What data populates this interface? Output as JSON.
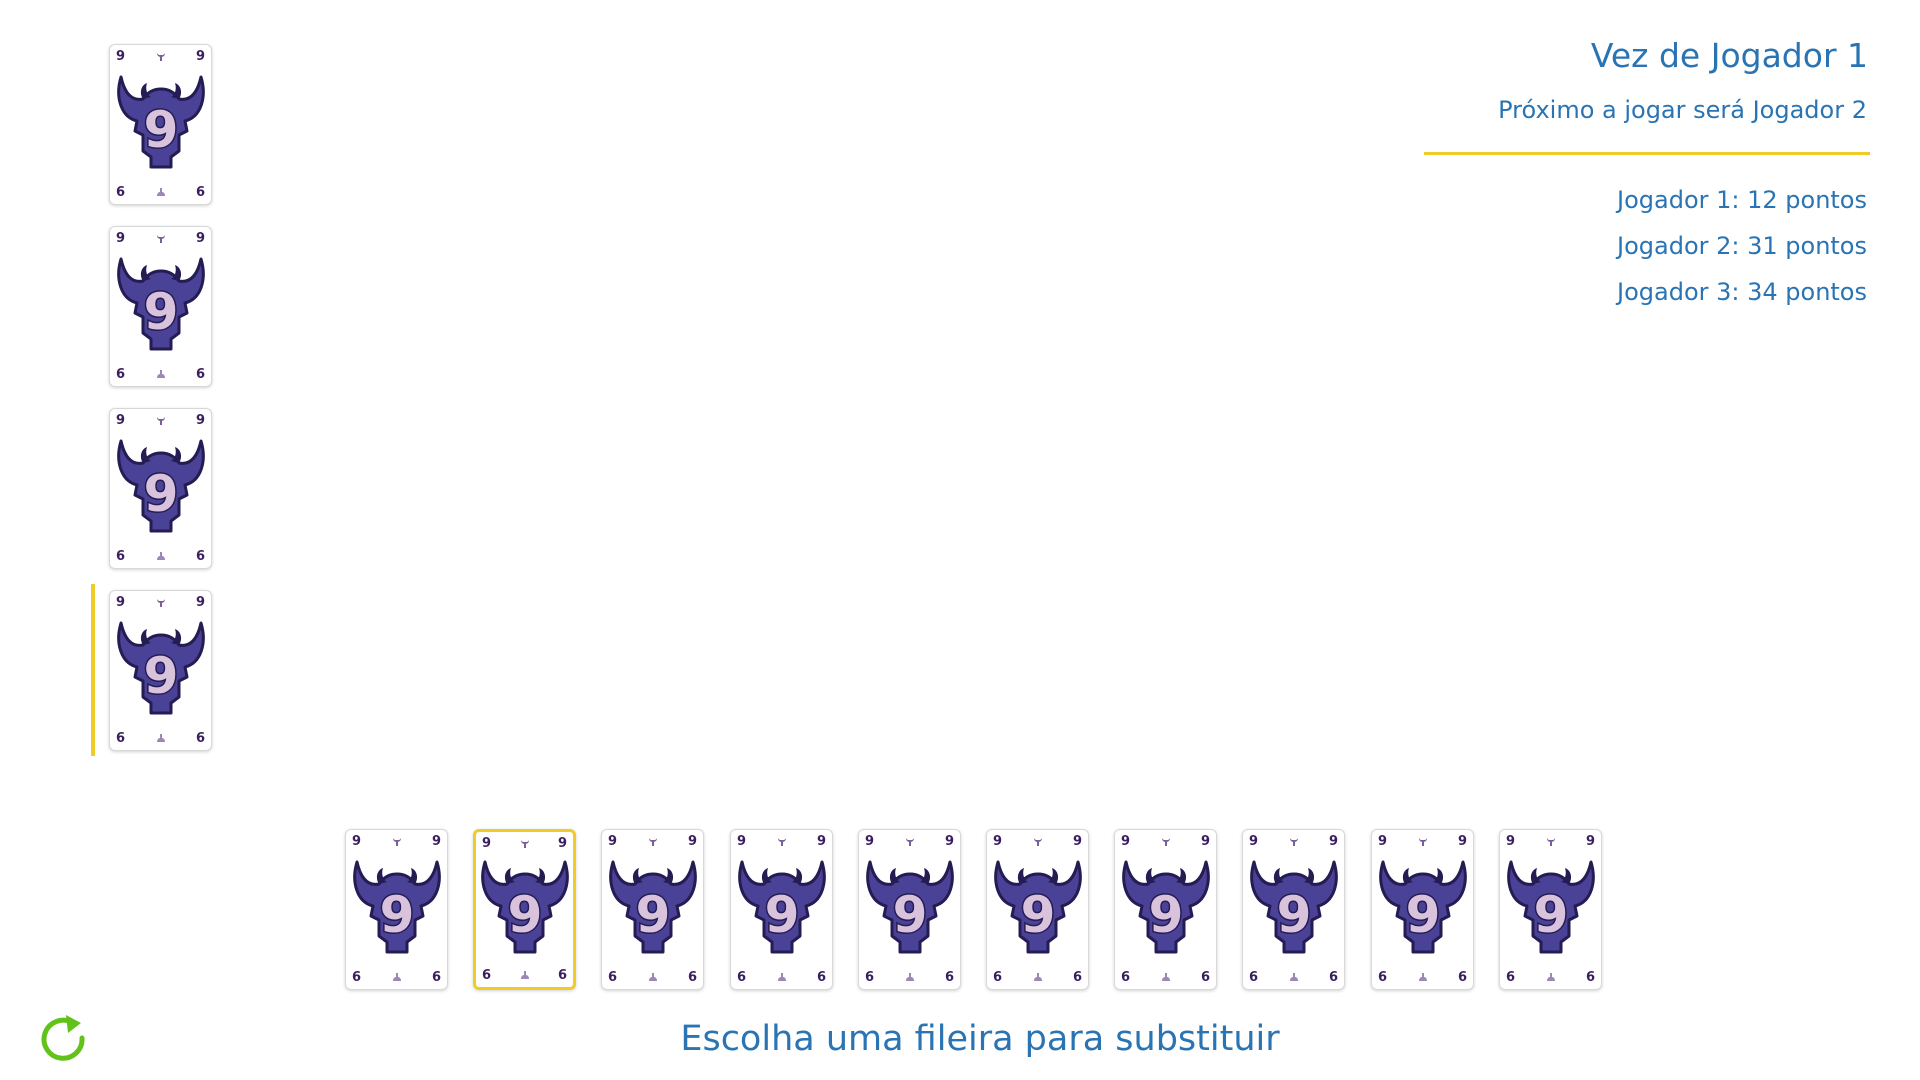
{
  "header": {
    "turn_title": "Vez de Jogador 1",
    "next_player": "Próximo a jogar será Jogador 2"
  },
  "scores": [
    "Jogador 1: 12 pontos",
    "Jogador 2: 31 pontos",
    "Jogador 3: 34 pontos"
  ],
  "instruction": "Escolha uma fileira para substituir",
  "card": {
    "value": "9",
    "penalty": "6",
    "icon": "bull-head-icon"
  },
  "rows": {
    "count": 4,
    "highlighted_row": 4
  },
  "hand": {
    "count": 10,
    "selected_card": 2
  },
  "colors": {
    "accent_blue": "#2a74b4",
    "highlight_yellow": "#f0cc28",
    "card_purple": "#4a4296",
    "restart_green": "#62c21a"
  },
  "restart_icon": "restart-icon"
}
